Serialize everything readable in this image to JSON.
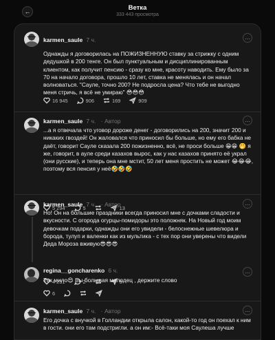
{
  "header": {
    "title": "Ветка",
    "views": "333 443 просмотра"
  },
  "posts": [
    {
      "username": "karmen_saule",
      "time": "7 ч.",
      "author_tag": "",
      "text": "Однажды я договорилась на ПОЖИЗНЕННУЮ ставку за стрижку с одним дедушкой в 200 тенге. Он был пунктуальным и дисциплинированным клиентом, как получит пенсию - сразу ко мне, красоту наводить. Ему было за 70 на начало договора, прошло 10 лет, ставка не менялась и он начал волноваться. \"Сауле, точно 200? Не подросла цена? Что тебе не выгодно меня стричь, я всё не умираю\" 😳😳😳",
      "likes": "16 945",
      "comments": "906",
      "reposts": "169",
      "shares": "909"
    },
    {
      "username": "karmen_saule",
      "time": "7 ч.",
      "author_tag": "· Автор",
      "text": "...а я отвечала что уговор дороже денег - договорились на 200, значит 200 и никаких гвоздей! Он жаловался что приносил бы больше, но ему его бабка не даёт, говорит Сауле сказала 200 пожизненно, всё, не проси больше 😁😁 🤭 я же, говорит, в ауле среди казахов вырос, как у нас казахов принято её украл (они русские), и теперь она мне мстит, 50 лет меня простить не может 😂😂😂, поэтому вся пенсия у неё🤣🤣🤣",
      "likes": "5 294",
      "comments": "5",
      "reposts": "",
      "shares": "13"
    },
    {
      "username": "karmen_saule",
      "time": "7 ч.",
      "author_tag": "· Автор",
      "text": "Но! Он на большие праздники всегда приносил мне с дочками сладости и вкусности. С огорода огурцы-помидоры это положняк. На Новый год моим девочкам подарки, однажды они его увидели - белоснежные шевелюра и борода, тулуп и валенки как из мультика - с тех пор они уверены что видели Деда Мороза вживую😎😎😎",
      "likes": "4 231",
      "comments": "2",
      "reposts": "",
      "shares": "9"
    },
    {
      "username": "regina__goncharenko",
      "time": "6 ч.",
      "author_tag": "",
      "text": "Так мило😍 Вы большая молодец , держите слово",
      "likes": "6",
      "comments": "",
      "reposts": "",
      "shares": ""
    },
    {
      "username": "karmen_saule",
      "time": "7 ч.",
      "author_tag": "· Автор",
      "text": "Его дочка с внучкой в Голландии открыла салон, какой-то год он поехал к ним в гости. они его там подстригли. а он им:- Всё-таки моя Саулеша лучше",
      "likes": "",
      "comments": "",
      "reposts": "",
      "shares": ""
    }
  ],
  "icons": {
    "back": "arrow-left-icon",
    "more": "ellipsis-icon",
    "like": "heart-icon",
    "comment": "comment-bubble-icon",
    "repost": "repost-arrows-icon",
    "share": "paper-plane-icon"
  }
}
